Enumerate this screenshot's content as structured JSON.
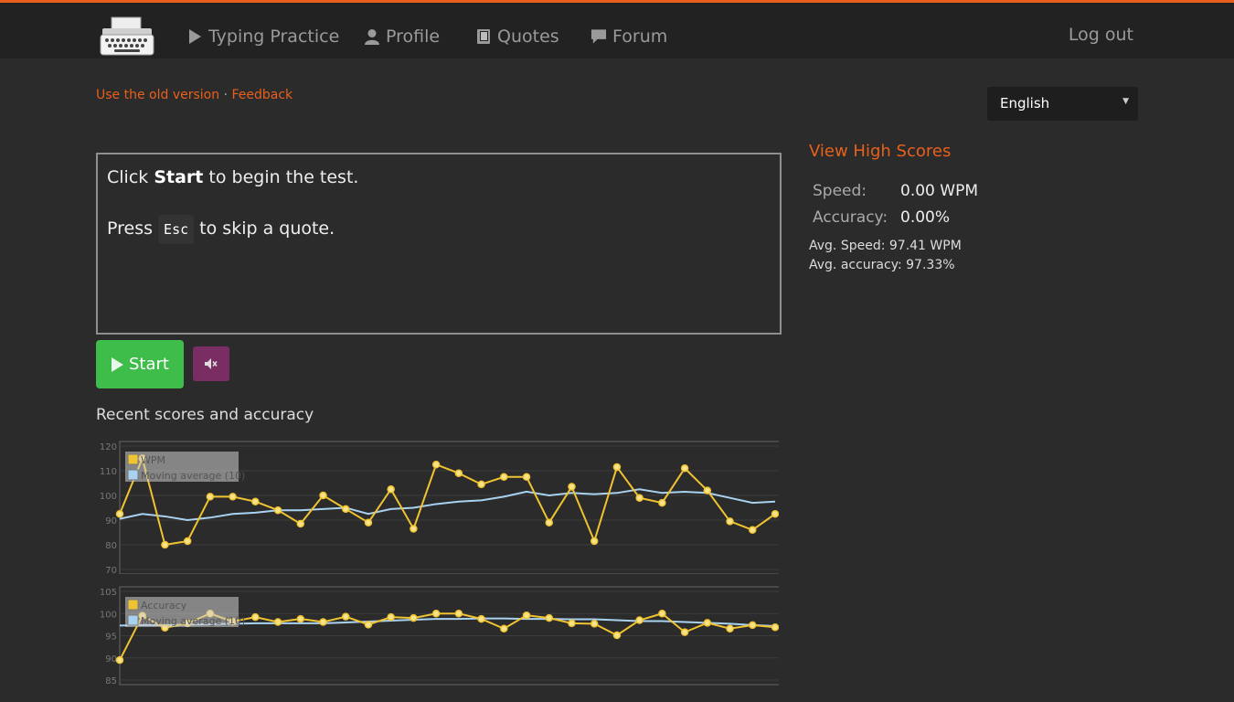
{
  "nav": {
    "logo_icon": "typewriter-icon",
    "items": [
      {
        "label": "Typing Practice",
        "icon": "play-icon"
      },
      {
        "label": "Profile",
        "icon": "user-icon"
      },
      {
        "label": "Quotes",
        "icon": "book-icon"
      },
      {
        "label": "Forum",
        "icon": "comment-icon"
      }
    ],
    "logout": "Log out",
    "accent_color": "#e8601c"
  },
  "links": {
    "old_version": "Use the old version",
    "separator": "·",
    "feedback": "Feedback"
  },
  "language": {
    "selected": "English"
  },
  "instructions": {
    "line1_pre": "Click ",
    "line1_bold": "Start",
    "line1_post": " to begin the test.",
    "line2_pre": "Press ",
    "line2_key": "Esc",
    "line2_post": " to skip a quote."
  },
  "buttons": {
    "start": "Start",
    "start_color": "#3ebd4a",
    "mute_icon": "mute-icon",
    "mute_color": "#7a2d63"
  },
  "recent_title": "Recent scores and accuracy",
  "stats": {
    "high_scores_link": "View High Scores",
    "speed_label": "Speed:",
    "speed_value": "0.00 WPM",
    "accuracy_label": "Accuracy:",
    "accuracy_value": "0.00%",
    "avg_speed": "Avg. Speed: 97.41 WPM",
    "avg_accuracy": "Avg. accuracy: 97.33%"
  },
  "chart_data": [
    {
      "type": "line",
      "ylim": [
        70,
        120
      ],
      "yticks": [
        "120",
        "110",
        "100",
        "90",
        "80",
        "70"
      ],
      "grid": true,
      "legend_position": "top-left",
      "series": [
        {
          "name": "WPM",
          "color": "#f0c330",
          "values": [
            92.5,
            115,
            80,
            81.5,
            99.5,
            99.5,
            97.5,
            94,
            88.5,
            100,
            94.5,
            89,
            102.5,
            86.5,
            112.5,
            109,
            104.5,
            107.5,
            107.5,
            89,
            103.5,
            81.5,
            111.5,
            99,
            97,
            111,
            102,
            89.5,
            86,
            92.5
          ]
        },
        {
          "name": "Moving average (10)",
          "color": "#a9d1f0",
          "values": [
            90.5,
            92.5,
            91.5,
            90,
            91,
            92.5,
            93,
            94,
            94,
            94.5,
            95,
            92.5,
            94.5,
            95,
            96.5,
            97.5,
            98,
            99.5,
            101.5,
            100,
            101,
            100.5,
            101,
            102.5,
            101,
            101.5,
            101,
            99,
            97,
            97.5
          ]
        }
      ]
    },
    {
      "type": "line",
      "ylim": [
        85,
        105
      ],
      "yticks": [
        "105",
        "100",
        "95",
        "90",
        "85"
      ],
      "grid": true,
      "legend_position": "top-left",
      "series": [
        {
          "name": "Accuracy",
          "color": "#f0c330",
          "values": [
            89.5,
            99.5,
            96.8,
            97.8,
            100,
            98.2,
            99.2,
            98.1,
            98.8,
            98.1,
            99.3,
            97.5,
            99.2,
            99,
            100,
            100,
            98.8,
            96.6,
            99.6,
            99,
            97.8,
            97.7,
            95.1,
            98.5,
            100,
            95.8,
            97.9,
            96.6,
            97.4,
            96.9
          ]
        },
        {
          "name": "Moving average (10)",
          "color": "#a9d1f0",
          "values": [
            97.3,
            97.4,
            97.4,
            97.5,
            97.6,
            97.7,
            97.8,
            97.8,
            97.8,
            97.8,
            98,
            98.2,
            98.4,
            98.6,
            98.8,
            98.8,
            98.9,
            98.9,
            98.8,
            98.8,
            98.7,
            98.7,
            98.5,
            98.3,
            98.3,
            98.1,
            97.9,
            97.7,
            97.4,
            97.2
          ]
        }
      ]
    }
  ]
}
